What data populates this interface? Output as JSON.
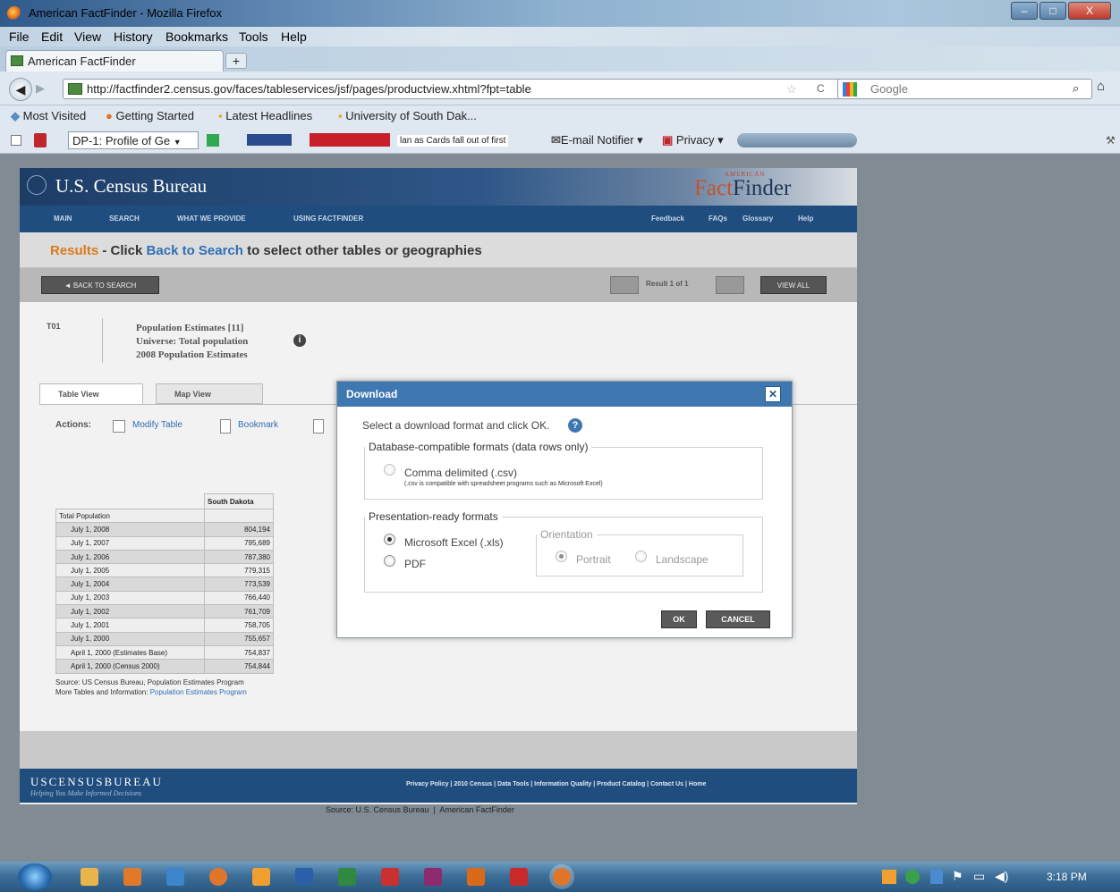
{
  "window": {
    "title": "American FactFinder - Mozilla Firefox",
    "minimize": "–",
    "maximize": "□",
    "close": "X"
  },
  "menubar": [
    "File",
    "Edit",
    "View",
    "History",
    "Bookmarks",
    "Tools",
    "Help"
  ],
  "tab": {
    "title": "American FactFinder",
    "new_tab": "+"
  },
  "navbar": {
    "url": "http://factfinder2.census.gov/faces/tableservices/jsf/pages/productview.xhtml?fpt=table",
    "search_placeholder": "Google"
  },
  "bookmarks": [
    "Most Visited",
    "Getting Started",
    "Latest Headlines",
    "University of South Dak..."
  ],
  "toolbar2": {
    "dropdown": "DP-1: Profile of Ge",
    "ticker": "lan as Cards fall out of first",
    "email": "E-mail Notifier",
    "privacy": "Privacy"
  },
  "site": {
    "logo_left": "U.S. Census Bureau",
    "logo_right_small": "AMERICAN",
    "logo_right": "FactFinder",
    "nav_left": [
      "MAIN",
      "SEARCH",
      "WHAT WE PROVIDE",
      "USING FACTFINDER"
    ],
    "nav_right": [
      "Feedback",
      "FAQs",
      "Glossary",
      "Help"
    ],
    "results_label": "Results",
    "results_dash": " - Click ",
    "results_link": "Back to Search",
    "results_rest": " to select other tables or geographies",
    "back_button": "◄ BACK TO SEARCH",
    "result_count": "Result 1 of 1",
    "view_all": "VIEW ALL",
    "table_id": "T01",
    "table_title": "Population Estimates [11]",
    "table_universe": "Universe: Total population",
    "table_year": "2008 Population Estimates",
    "tab_table": "Table View",
    "tab_map": "Map View",
    "actions_label": "Actions:",
    "action_modify": "Modify Table",
    "action_bookmark": "Bookmark"
  },
  "data_table": {
    "header": "South Dakota",
    "section": "Total Population",
    "rows": [
      {
        "label": "July 1, 2008",
        "value": "804,194"
      },
      {
        "label": "July 1, 2007",
        "value": "795,689"
      },
      {
        "label": "July 1, 2006",
        "value": "787,380"
      },
      {
        "label": "July 1, 2005",
        "value": "779,315"
      },
      {
        "label": "July 1, 2004",
        "value": "773,539"
      },
      {
        "label": "July 1, 2003",
        "value": "766,440"
      },
      {
        "label": "July 1, 2002",
        "value": "761,709"
      },
      {
        "label": "July 1, 2001",
        "value": "758,705"
      },
      {
        "label": "July 1, 2000",
        "value": "755,657"
      },
      {
        "label": "April 1, 2000 (Estimates Base)",
        "value": "754,837"
      },
      {
        "label": "April 1, 2000 (Census 2000)",
        "value": "754,844"
      }
    ],
    "source": "Source: US Census Bureau, Population Estimates Program",
    "more_label": "More Tables and Information: ",
    "more_link": "Population Estimates Program"
  },
  "footer": {
    "logo": "USCENSUSBUREAU",
    "tagline": "Helping You Make Informed Decisions",
    "links": [
      "Privacy Policy",
      "2010 Census",
      "Data Tools",
      "Information Quality",
      "Product Catalog",
      "Contact Us",
      "Home"
    ],
    "source": "Source: U.S. Census Bureau  |  American FactFinder"
  },
  "dialog": {
    "title": "Download",
    "close": "✕",
    "instruction": "Select a download format and click OK.",
    "db_legend": "Database-compatible formats (data rows only)",
    "csv_label": "Comma delimited (.csv)",
    "csv_note": "(.csv is compatible with spreadsheet programs such as Microsoft Excel)",
    "pres_legend": "Presentation-ready formats",
    "xls_label": "Microsoft Excel (.xls)",
    "pdf_label": "PDF",
    "orientation_legend": "Orientation",
    "portrait": "Portrait",
    "landscape": "Landscape",
    "ok": "OK",
    "cancel": "CANCEL",
    "selected_format": "Microsoft Excel (.xls)",
    "selected_orientation": "Portrait"
  },
  "taskbar": {
    "clock": "3:18 PM"
  },
  "colors": {
    "accent": "#3f78b0",
    "results_orange": "#d87a1a",
    "link_blue": "#2e6fb3",
    "nav_dark": "#1f4d7e"
  }
}
